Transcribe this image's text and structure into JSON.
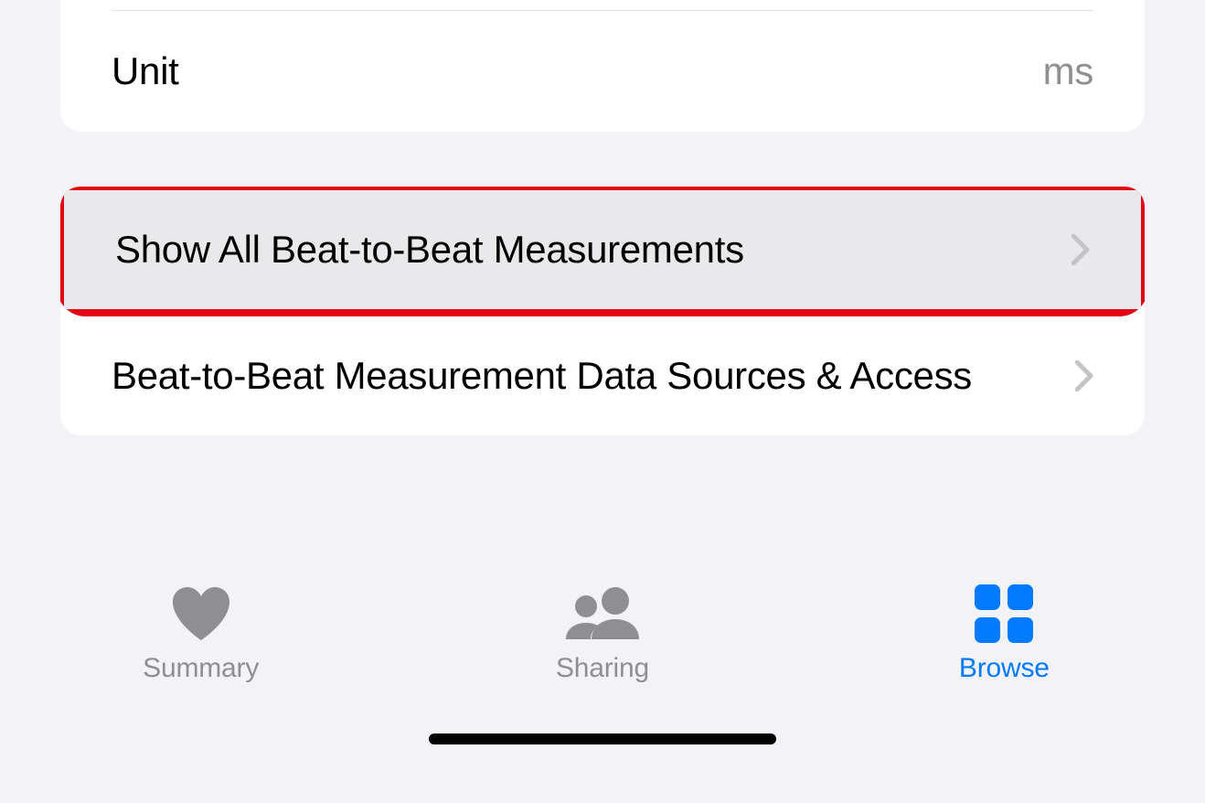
{
  "unit_row": {
    "label": "Unit",
    "value": "ms"
  },
  "nav_rows": {
    "show_all": "Show All Beat-to-Beat Measurements",
    "data_sources": "Beat-to-Beat Measurement Data Sources & Access"
  },
  "tabs": {
    "summary": "Summary",
    "sharing": "Sharing",
    "browse": "Browse"
  }
}
